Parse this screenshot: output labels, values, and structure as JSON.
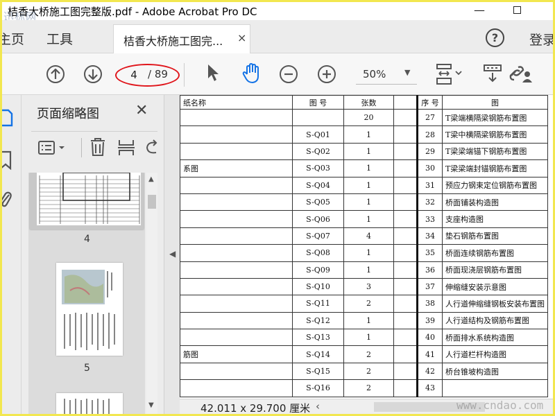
{
  "window": {
    "title": "桔香大桥施工图完整版.pdf - Adobe Acrobat Pro DC",
    "watermark_top": "迅标网",
    "minimize_glyph": "—"
  },
  "nav": {
    "home": "主页",
    "tools": "工具",
    "doc_tab": "桔香大桥施工图完...",
    "close_glyph": "×",
    "help_glyph": "?",
    "login": "登录"
  },
  "toolbar": {
    "current_page": "4",
    "page_total": "/ 89",
    "zoom": "50%",
    "highlight_color": "#e0151b",
    "hand_tool_color": "#1473e6"
  },
  "panel": {
    "title": "页面缩略图",
    "close_glyph": "✕",
    "thumb_labels": [
      "4",
      "5"
    ]
  },
  "sheet": {
    "header": [
      "纸名称",
      "图  号",
      "张数",
      "",
      "序  号",
      "图"
    ],
    "rows": [
      [
        "",
        "",
        "20",
        "",
        "27",
        "T梁端横隔梁钢筋布置图"
      ],
      [
        "",
        "S-Q01",
        "1",
        "",
        "28",
        "T梁中横隔梁钢筋布置图"
      ],
      [
        "",
        "S-Q02",
        "1",
        "",
        "29",
        "T梁梁端锚下钢筋布置图"
      ],
      [
        "系图",
        "S-Q03",
        "1",
        "",
        "30",
        "T梁梁端封锚钢筋布置图"
      ],
      [
        "",
        "S-Q04",
        "1",
        "",
        "31",
        "预应力钢束定位钢筋布置图"
      ],
      [
        "",
        "S-Q05",
        "1",
        "",
        "32",
        "桥面铺装构造图"
      ],
      [
        "",
        "S-Q06",
        "1",
        "",
        "33",
        "支座构造图"
      ],
      [
        "",
        "S-Q07",
        "4",
        "",
        "34",
        "垫石钢筋布置图"
      ],
      [
        "",
        "S-Q08",
        "1",
        "",
        "35",
        "桥面连续钢筋布置图"
      ],
      [
        "",
        "S-Q09",
        "1",
        "",
        "36",
        "桥面现浇层钢筋布置图"
      ],
      [
        "",
        "S-Q10",
        "3",
        "",
        "37",
        "伸缩缝安装示意图"
      ],
      [
        "",
        "S-Q11",
        "2",
        "",
        "38",
        "人行道伸缩缝钢板安装布置图"
      ],
      [
        "",
        "S-Q12",
        "1",
        "",
        "39",
        "人行道结构及钢筋布置图"
      ],
      [
        "",
        "S-Q13",
        "1",
        "",
        "40",
        "桥面排水系统构造图"
      ],
      [
        "筋图",
        "S-Q14",
        "2",
        "",
        "41",
        "人行道栏杆构造图"
      ],
      [
        "",
        "S-Q15",
        "2",
        "",
        "42",
        "桥台锥坡构造图"
      ],
      [
        "",
        "S-Q16",
        "2",
        "",
        "43",
        ""
      ]
    ]
  },
  "status": {
    "dimensions": "42.011 x 29.700 厘米",
    "watermark": "www.cndao.com"
  }
}
